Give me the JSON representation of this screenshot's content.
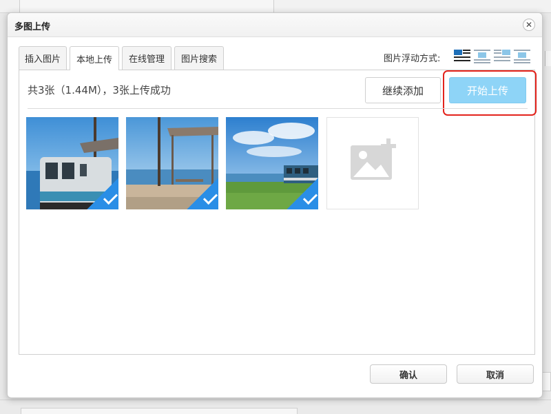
{
  "dialog": {
    "title": "多图上传",
    "close_glyph": "✕"
  },
  "tabs": [
    {
      "label": "插入图片",
      "active": false
    },
    {
      "label": "本地上传",
      "active": true
    },
    {
      "label": "在线管理",
      "active": false
    },
    {
      "label": "图片搜索",
      "active": false
    }
  ],
  "float_mode": {
    "label": "图片浮动方式:",
    "options": [
      "float-left-icon",
      "float-none-icon",
      "float-right-icon",
      "float-center-icon"
    ],
    "selected": 0
  },
  "upload": {
    "info_text": "共3张（1.44M），3张上传成功",
    "continue_label": "继续添加",
    "start_label": "开始上传",
    "highlight_color": "#e3221b"
  },
  "images": [
    {
      "name": "train-station-photo-1",
      "uploaded": true
    },
    {
      "name": "train-station-photo-2",
      "uploaded": true
    },
    {
      "name": "train-station-photo-3",
      "uploaded": true
    }
  ],
  "add_tile": {
    "icon": "add-image-icon"
  },
  "footer": {
    "ok_label": "确认",
    "cancel_label": "取消"
  },
  "colors": {
    "accent": "#2a8ee6",
    "start_button": "#8ed4f7"
  }
}
